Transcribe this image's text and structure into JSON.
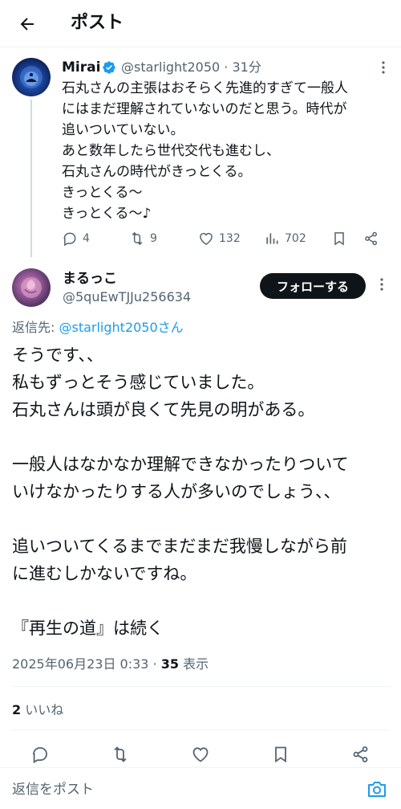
{
  "header": {
    "title": "ポスト"
  },
  "parent_post": {
    "display_name": "Mirai",
    "handle": "@starlight2050",
    "time_sep": "·",
    "time": "31分",
    "text": "石丸さんの主張はおそらく先進的すぎて一般人\nにはまだ理解されていないのだと思う。時代が\n追いついていない。\nあと数年したら世代交代も進むし、\n石丸さんの時代がきっとくる。\nきっとくる〜\nきっとくる〜♪",
    "replies": "4",
    "reposts": "9",
    "likes": "132",
    "views": "702"
  },
  "main_post": {
    "display_name": "まるっこ",
    "handle": "@5quEwTJJu256634",
    "follow_label": "フォローする",
    "reply_to_prefix": "返信先: ",
    "reply_to_handle": "@starlight2050",
    "reply_to_suffix": "さん",
    "text": "そうです、、\n私もずっとそう感じていました。\n石丸さんは頭が良くて先見の明がある。\n\n一般人はなかなか理解できなかったりついて\nいけなかったりする人が多いのでしょう、、\n\n追いついてくるまでまだまだ我慢しながら前\nに進むしかないですね。\n\n『再生の道』は続く",
    "timestamp": "2025年06月23日 0:33 · ",
    "views_count": "35",
    "views_label": " 表示",
    "likes_count": "2",
    "likes_label": " いいね"
  },
  "composer": {
    "placeholder": "返信をポスト"
  },
  "icons": {
    "back": "arrow-left-icon",
    "verified": "verified-badge-icon",
    "more": "more-vertical-icon",
    "reply": "reply-icon",
    "repost": "repost-icon",
    "like": "heart-icon",
    "views": "analytics-icon",
    "bookmark": "bookmark-icon",
    "share": "share-icon",
    "camera": "camera-icon"
  },
  "colors": {
    "accent": "#1d9bf0",
    "text": "#0f1419",
    "muted": "#536471",
    "follow_bg": "#0f1419"
  }
}
